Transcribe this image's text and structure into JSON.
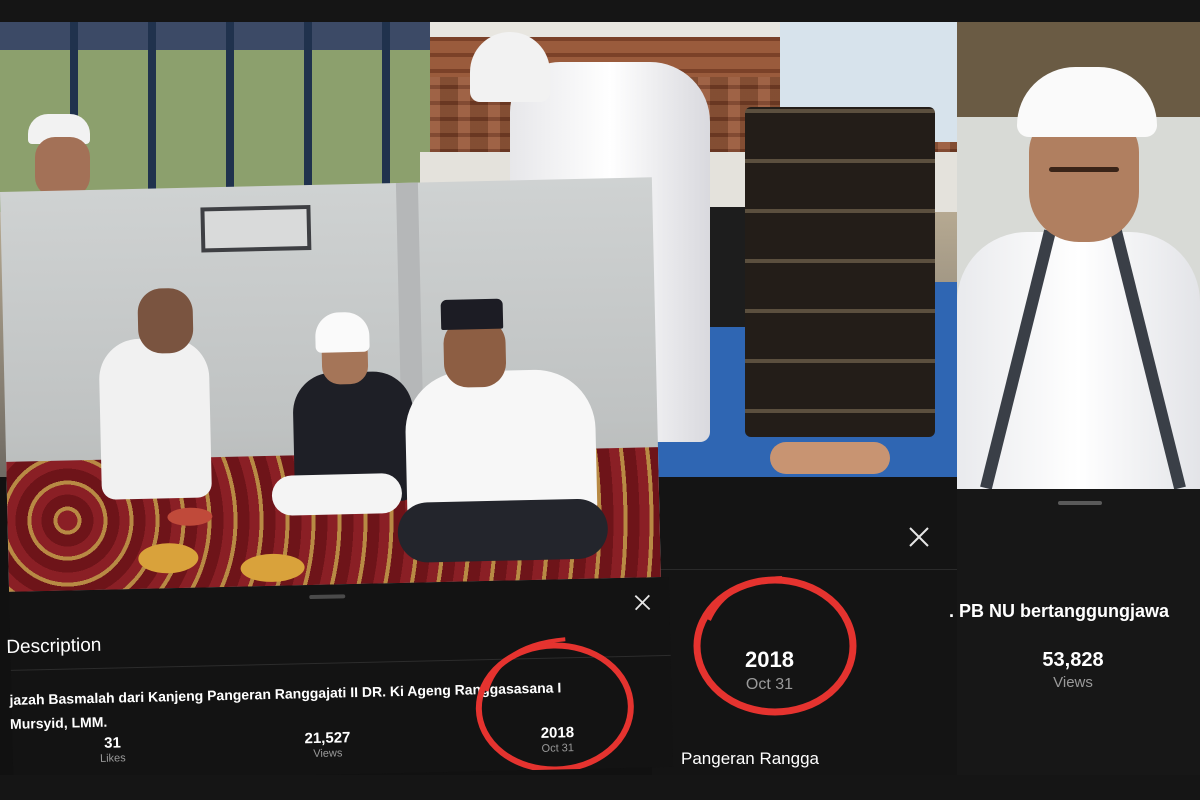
{
  "front_card": {
    "description_heading": "Description",
    "description_line1": "jazah Basmalah dari Kanjeng Pangeran Ranggajati II DR. Ki Ageng Ranggasasana I",
    "description_line2": "Mursyid, LMM.",
    "likes_value": "31",
    "likes_label": "Likes",
    "views_value": "21,527",
    "views_label": "Views",
    "year": "2018",
    "date": "Oct 31"
  },
  "middle_card": {
    "year": "2018",
    "date": "Oct 31",
    "title_fragment": "Pangeran Rangga"
  },
  "right_card": {
    "title_fragment": ". PB NU bertanggungjawa",
    "views_value": "53,828",
    "views_label": "Views"
  },
  "colors": {
    "annotation_circle": "#e5332f",
    "sheet_background": "#141414",
    "muted_text": "#9a9a9a"
  }
}
